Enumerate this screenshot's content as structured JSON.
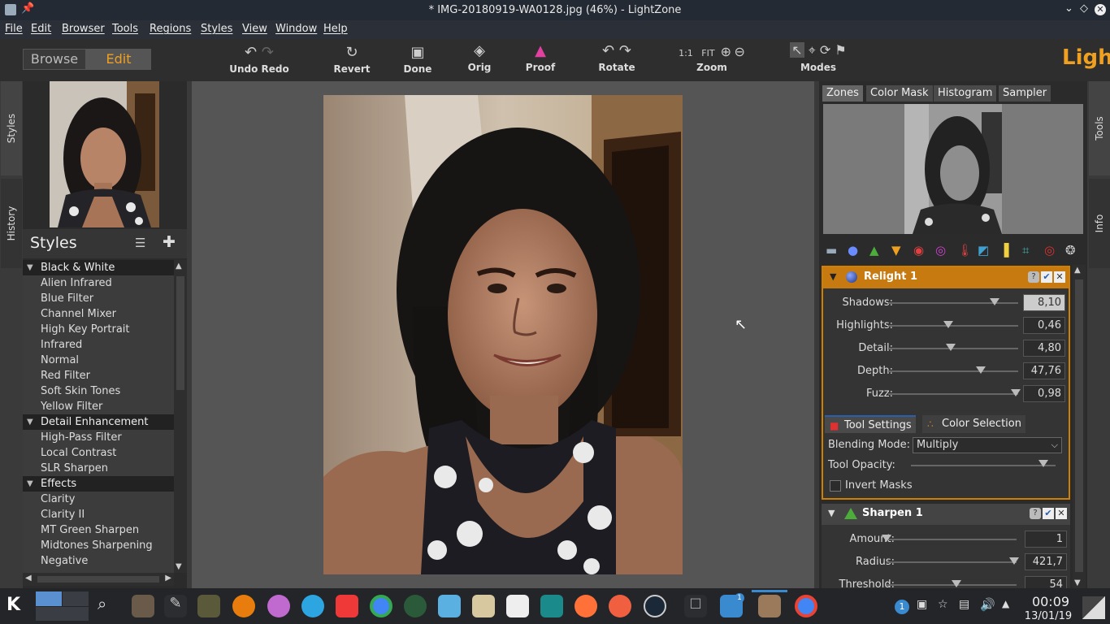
{
  "window": {
    "title": "* IMG-20180919-WA0128.jpg (46%) - LightZone"
  },
  "menu": [
    "File",
    "Edit",
    "Browser",
    "Tools",
    "Regions",
    "Styles",
    "View",
    "Window",
    "Help"
  ],
  "toolbar": {
    "browse": "Browse",
    "edit": "Edit",
    "undo_redo": "Undo Redo",
    "revert": "Revert",
    "done": "Done",
    "orig": "Orig",
    "proof": "Proof",
    "rotate": "Rotate",
    "zoom_1to1": "1:1",
    "zoom_fit": "FIT",
    "zoom": "Zoom",
    "modes": "Modes",
    "brand": "Light"
  },
  "left_tabs": {
    "styles": "Styles",
    "history": "History"
  },
  "styles_panel": {
    "title": "Styles",
    "categories": [
      {
        "name": "Black & White",
        "items": [
          "Alien Infrared",
          "Blue Filter",
          "Channel Mixer",
          "High Key Portrait",
          "Infrared",
          "Normal",
          "Red Filter",
          "Soft Skin Tones",
          "Yellow Filter"
        ]
      },
      {
        "name": "Detail Enhancement",
        "items": [
          "High-Pass Filter",
          "Local Contrast",
          "SLR Sharpen"
        ]
      },
      {
        "name": "Effects",
        "items": [
          "Clarity",
          "Clarity II",
          "MT Green Sharpen",
          "Midtones Sharpening",
          "Negative"
        ]
      }
    ]
  },
  "right_tabs": {
    "zones": "Zones",
    "color_mask": "Color Mask",
    "histogram": "Histogram",
    "sampler": "Sampler"
  },
  "side_tabs": {
    "tools": "Tools",
    "info": "Info"
  },
  "relight": {
    "name": "Relight 1",
    "sliders": [
      {
        "label": "Shadows:",
        "value": "8,10",
        "pos": 0.82
      },
      {
        "label": "Highlights:",
        "value": "0,46",
        "pos": 0.46
      },
      {
        "label": "Detail:",
        "value": "4,80",
        "pos": 0.48
      },
      {
        "label": "Depth:",
        "value": "47,76",
        "pos": 0.71
      },
      {
        "label": "Fuzz:",
        "value": "0,98",
        "pos": 0.98
      }
    ],
    "tab_tool_settings": "Tool Settings",
    "tab_color_selection": "Color Selection",
    "blending_label": "Blending Mode:",
    "blending_value": "Multiply",
    "opacity_label": "Tool Opacity:",
    "opacity_pos": 0.95,
    "invert_label": "Invert Masks"
  },
  "sharpen": {
    "name": "Sharpen 1",
    "sliders": [
      {
        "label": "Amount:",
        "value": "1",
        "pos": 0.0
      },
      {
        "label": "Radius:",
        "value": "421,7",
        "pos": 0.98
      },
      {
        "label": "Threshold:",
        "value": "54",
        "pos": 0.54
      }
    ]
  },
  "taskbar": {
    "clock": "00:09",
    "date": "13/01/19",
    "badge": "1"
  }
}
